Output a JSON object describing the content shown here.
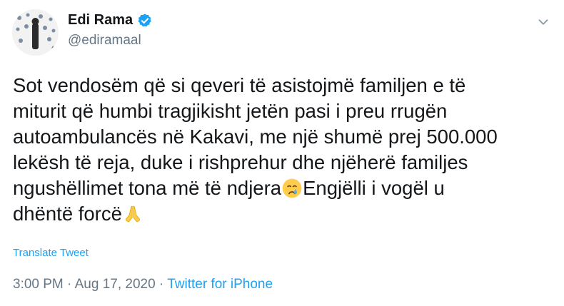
{
  "author": {
    "display_name": "Edi Rama",
    "handle": "@ediramaal",
    "verified": true
  },
  "tweet": {
    "lines": [
      "Sot vendosëm që si qeveri të asistojmë familjen e të",
      "miturit që humbi tragjikisht jetën pasi i preu rrugën",
      "autoambulancës në Kakavi, me një shumë prej 500.000",
      "lekësh të reja, duke i rishprehur dhe njëherë familjes",
      "ngushëllimet tona më të ndjera"
    ],
    "line5_after_emoji": "Engjëlli i vogël u",
    "line6": "dhëntë forcë",
    "emojis": [
      "crying-face-icon",
      "folded-hands-icon"
    ]
  },
  "translate_label": "Translate Tweet",
  "meta": {
    "time": "3:00 PM",
    "separator": " · ",
    "date": "Aug 17, 2020",
    "source": "Twitter for iPhone"
  },
  "colors": {
    "text": "#14171a",
    "secondary": "#657786",
    "link": "#1da1f2",
    "verified": "#1da1f2"
  }
}
